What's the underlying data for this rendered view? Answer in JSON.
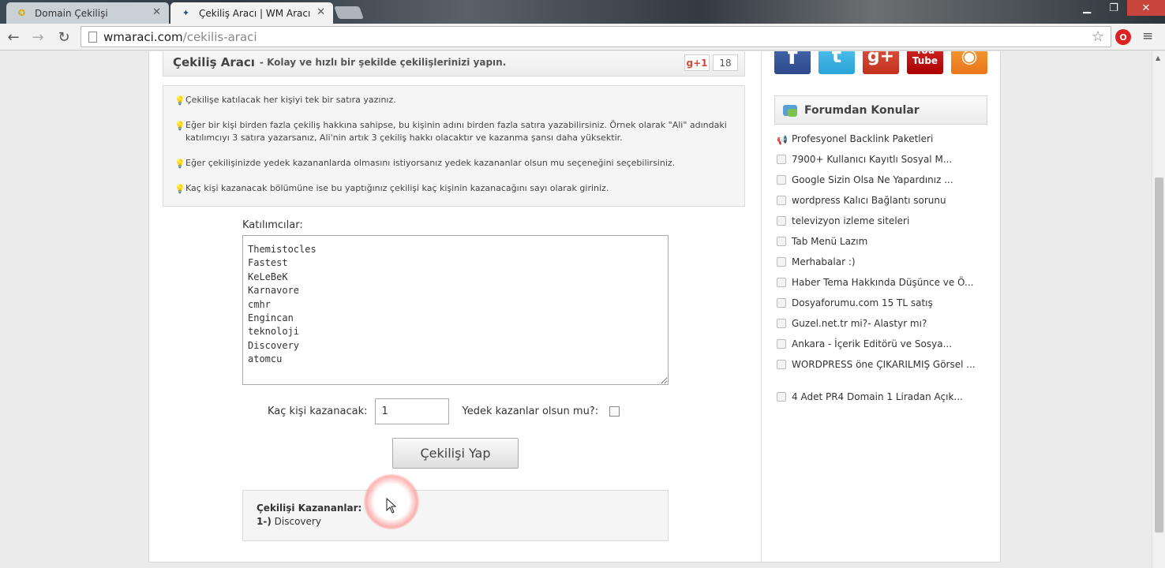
{
  "browser": {
    "tabs": [
      {
        "title": "Domain Çekilişi",
        "active": false,
        "icon": "star-favicon"
      },
      {
        "title": "Çekiliş Aracı | WM Aracı",
        "active": true,
        "icon": "wm-favicon"
      }
    ],
    "url_host": "wmaraci.com",
    "url_path": "/cekilis-araci",
    "window_controls": {
      "minimize": "▁",
      "maximize": "❐",
      "close": "✕"
    }
  },
  "header": {
    "title": "Çekiliş Aracı",
    "subtitle": "- Kolay ve hızlı bir şekilde çekilişlerinizi yapın.",
    "gplus_label": "g+1",
    "gplus_count": "18"
  },
  "tips": [
    "Çekilişe katılacak her kişiyi tek bir satıra yazınız.",
    "Eğer bir kişi birden fazla çekiliş hakkına sahipse, bu kişinin adını birden fazla satıra yazabilirsiniz. Örnek olarak \"Ali\" adındaki katılımcıyı 3 satıra yazarsanız, Ali'nin artık 3 çekiliş hakkı olacaktır ve kazanma şansı daha yüksektir.",
    "Eğer çekilişinizde yedek kazananlarda olmasını istiyorsanız yedek kazananlar olsun mu seçeneğini seçebilirsiniz.",
    "Kaç kişi kazanacak bölümüne ise bu yaptığınız çekilişi kaç kişinin kazanacağını sayı olarak giriniz."
  ],
  "form": {
    "participants_label": "Katılımcılar:",
    "participants": "Themistocles\nFastest\nKeLeBeK\nKarnavore\ncmhr\nEngincan\nteknoloji\nDiscovery\natomcu",
    "winners_label": "Kaç kişi kazanacak:",
    "winners_value": "1",
    "backup_label": "Yedek kazanlar olsun mu?:",
    "draw_button": "Çekilişi Yap"
  },
  "result": {
    "title": "Çekilişi Kazananlar:",
    "rank": "1-)",
    "winner": "Discovery"
  },
  "sidebar": {
    "social": [
      "f",
      "t",
      "g+",
      "You\nTube",
      "rss"
    ],
    "forum_title": "Forumdan Konular",
    "topics": [
      "Profesyonel Backlink Paketleri",
      "7900+ Kullanıcı Kayıtlı Sosyal M...",
      "Google Sizin Olsa Ne Yapardınız ...",
      "wordpress Kalıcı Bağlantı sorunu",
      "televizyon izleme siteleri",
      "Tab Menü Lazım",
      "Merhabalar :)",
      "Haber Tema Hakkında Düşünce ve Ö...",
      "Dosyaforumu.com 15 TL satış",
      "Guzel.net.tr mi?- Alastyr mı?",
      "Ankara - İçerik Editörü ve Sosya...",
      "WORDPRESS öne ÇIKARILMIŞ Görsel ...",
      "4 Adet PR4 Domain 1 Liradan Açık..."
    ]
  },
  "colors": {
    "accent": "#d14836",
    "facebook": "#3b5998",
    "twitter": "#2aa3d8",
    "youtube": "#cc0000",
    "rss": "#f0801f"
  }
}
